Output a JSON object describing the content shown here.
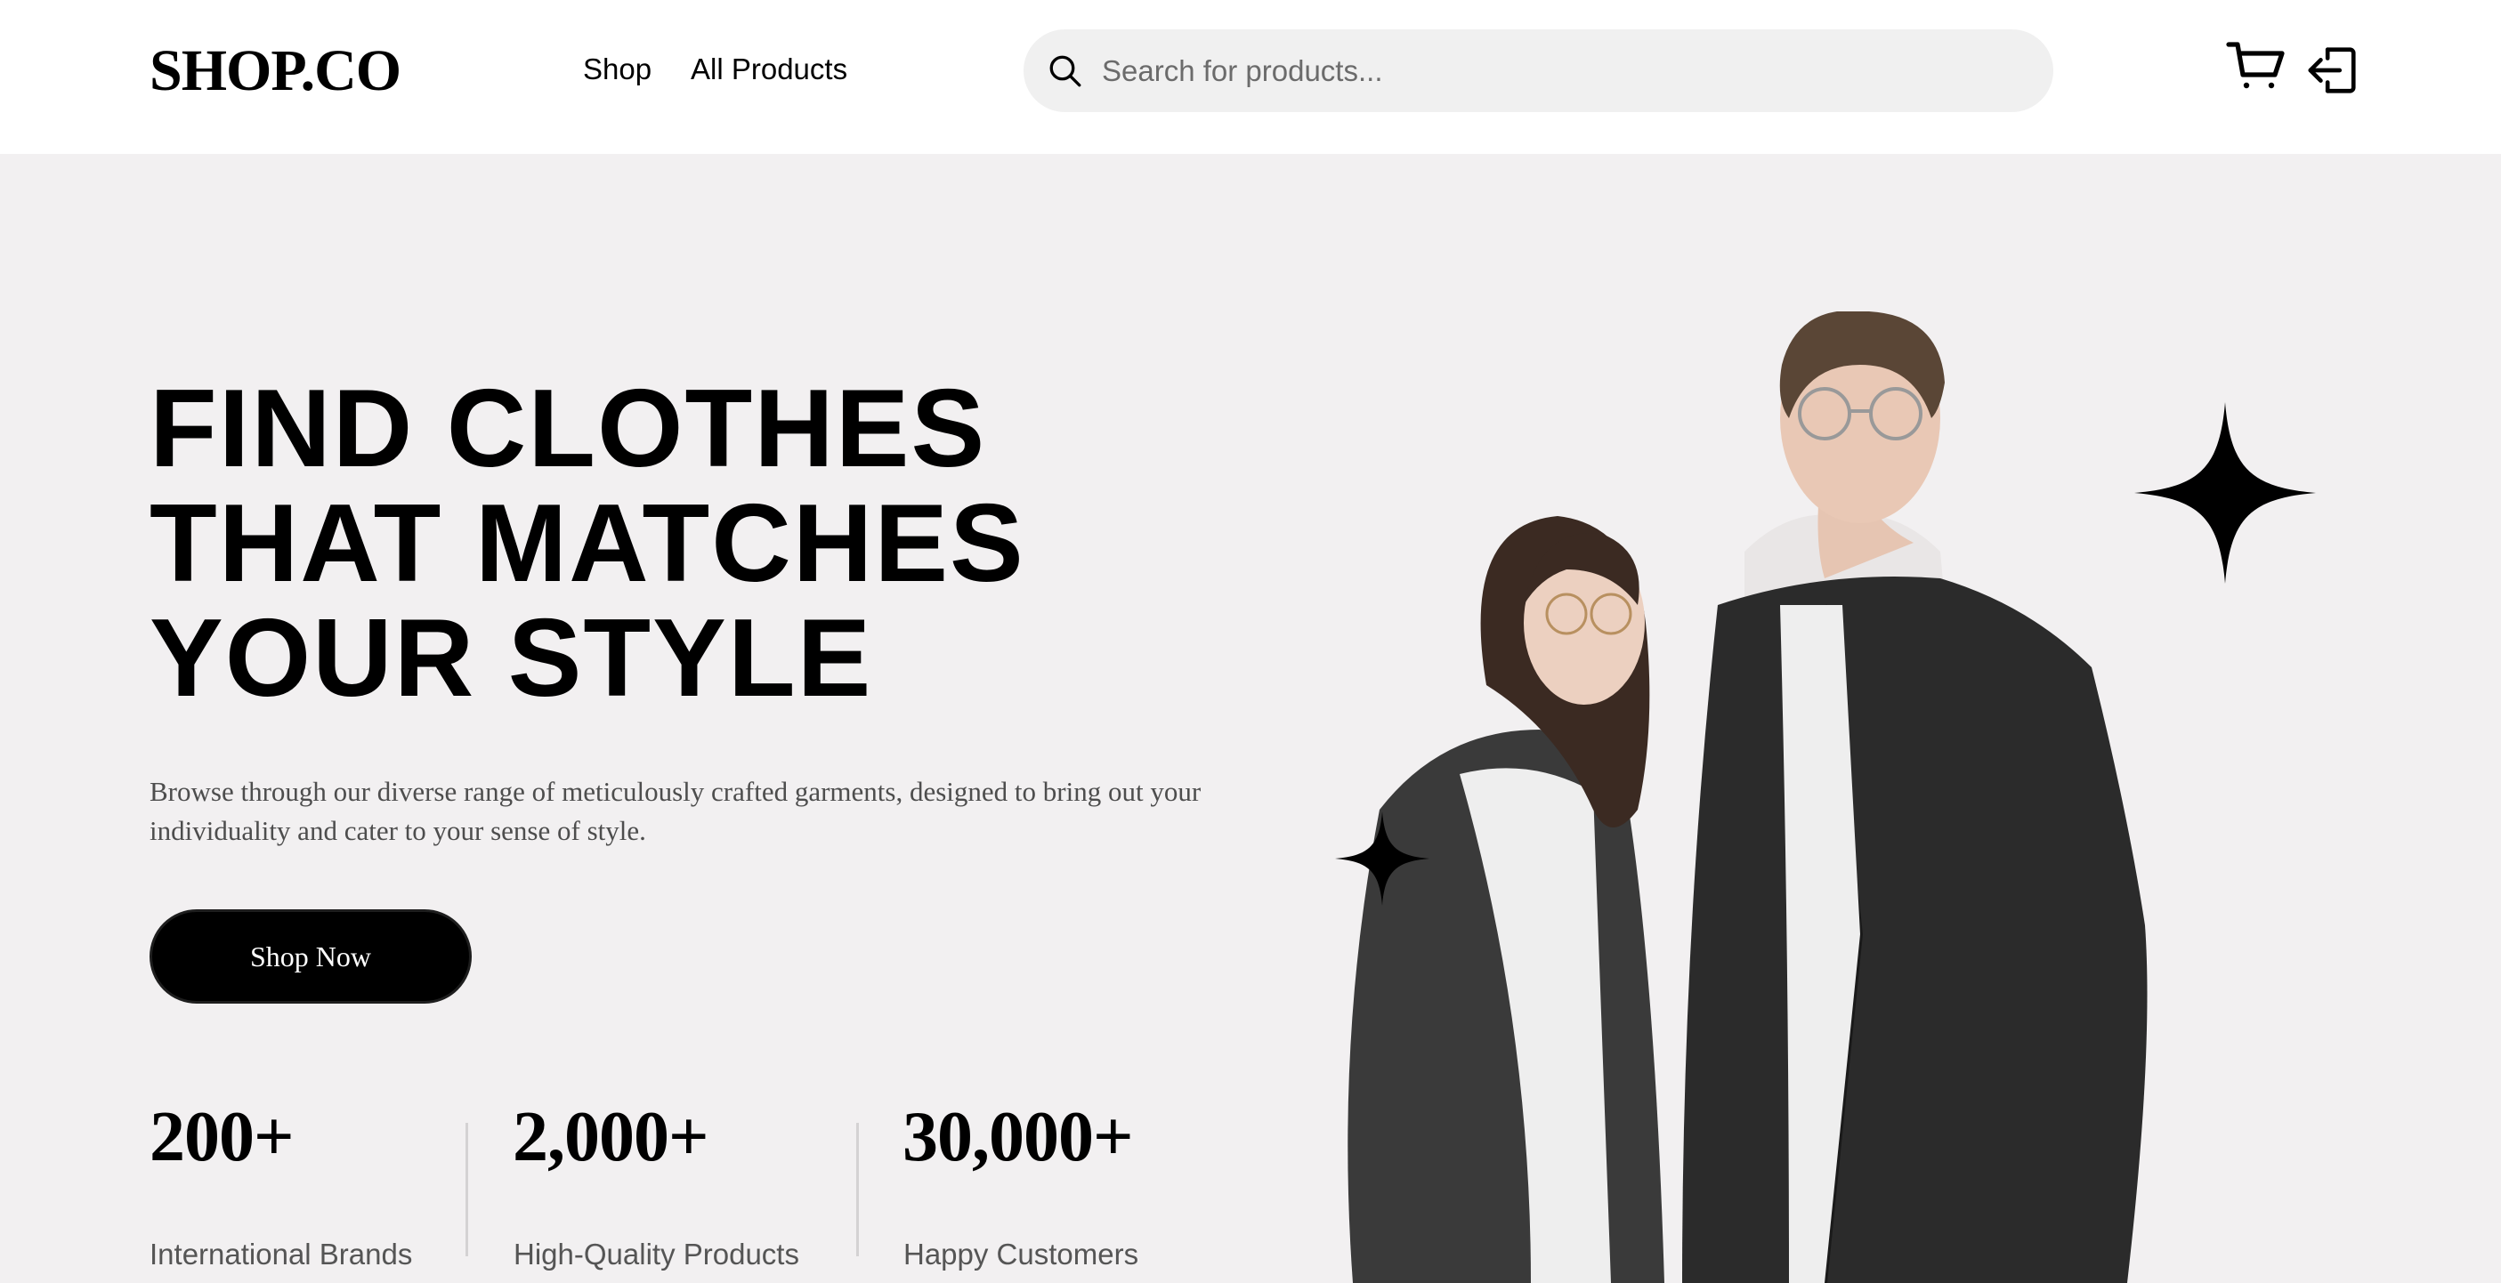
{
  "header": {
    "logo": "SHOP.CO",
    "nav": {
      "shop": "Shop",
      "all_products": "All Products"
    },
    "search": {
      "placeholder": "Search for products...",
      "value": ""
    },
    "icons": {
      "search": "search-icon",
      "cart": "cart-icon",
      "login": "login-icon"
    }
  },
  "hero": {
    "title_lines": [
      "FIND CLOTHES",
      "THAT MATCHES",
      "YOUR STYLE"
    ],
    "description": "Browse through our diverse range of meticulously crafted garments, designed to bring out your individuality and cater to your sense of style.",
    "cta_label": "Shop Now",
    "stats": [
      {
        "value": "200+",
        "label": "International Brands"
      },
      {
        "value": "2,000+",
        "label": "High-Quality Products"
      },
      {
        "value": "30,000+",
        "label": "Happy Customers"
      }
    ],
    "image_alt": "Couple wearing black denim jackets over white hoodies"
  },
  "colors": {
    "background": "#F2F0F1",
    "header": "#FFFFFF",
    "primary": "#000000",
    "search_bg": "#F0F0F0",
    "muted_text": "#4D4D4D"
  }
}
